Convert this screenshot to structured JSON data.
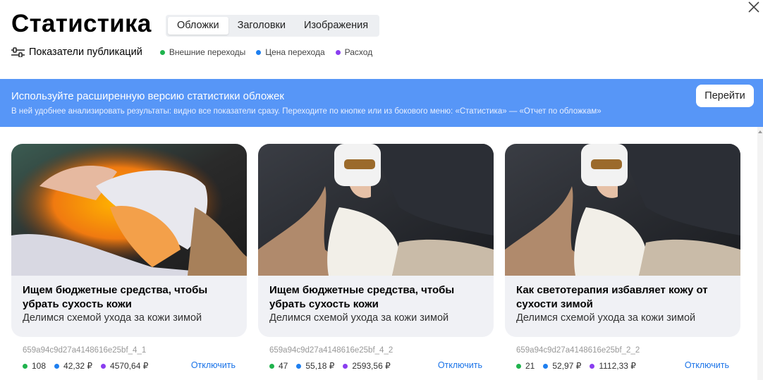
{
  "header": {
    "title": "Статистика",
    "tabs": [
      {
        "label": "Обложки",
        "active": true
      },
      {
        "label": "Заголовки",
        "active": false
      },
      {
        "label": "Изображения",
        "active": false
      }
    ],
    "metrics_label": "Показатели публикаций",
    "legend": [
      {
        "label": "Внешние переходы",
        "color": "#1fb34d"
      },
      {
        "label": "Цена перехода",
        "color": "#1e7ff0"
      },
      {
        "label": "Расход",
        "color": "#8a3ef0"
      }
    ]
  },
  "banner": {
    "title": "Используйте расширенную версию статистики обложек",
    "description": "В ней удобнее анализировать результаты: видно все показатели сразу. Переходите по кнопке или из бокового меню: «Статистика» — «Отчет по обложкам»",
    "button_label": "Перейти",
    "color": "#5796f7"
  },
  "cards": [
    {
      "title": "Ищем бюджетные средства, чтобы убрать сухость кожи",
      "subtitle": "Делимся схемой ухода за кожи зимой",
      "id": "659a94c9d27a4148616e25bf_4_1",
      "clicks": "108",
      "price": "42,32 ₽",
      "spend": "4570,64 ₽",
      "action": "Отключить"
    },
    {
      "title": "Ищем бюджетные средства, чтобы убрать сухость кожи",
      "subtitle": "Делимся схемой ухода за кожи зимой",
      "id": "659a94c9d27a4148616e25bf_4_2",
      "clicks": "47",
      "price": "55,18 ₽",
      "spend": "2593,56 ₽",
      "action": "Отключить"
    },
    {
      "title": "Как светотерапия избавляет кожу от сухости зимой",
      "subtitle": "Делимся схемой ухода за кожи зимой",
      "id": "659a94c9d27a4148616e25bf_2_2",
      "clicks": "21",
      "price": "52,97 ₽",
      "spend": "1112,33 ₽",
      "action": "Отключить"
    }
  ]
}
